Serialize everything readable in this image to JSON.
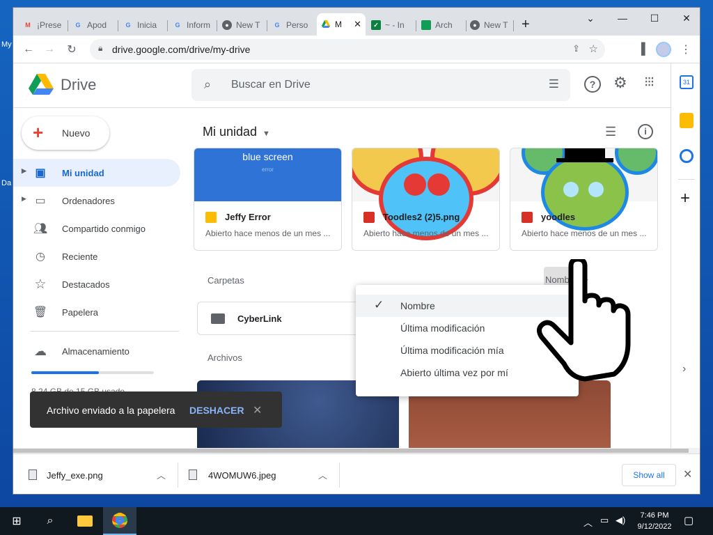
{
  "desktop": {
    "label_1": "My",
    "label_2": "Da"
  },
  "browser": {
    "tabs": [
      {
        "label": "¡Prese",
        "icon": "gmail-icon"
      },
      {
        "label": "Apod",
        "icon": "google-icon"
      },
      {
        "label": "Inicia",
        "icon": "google-icon"
      },
      {
        "label": "Inform",
        "icon": "google-icon"
      },
      {
        "label": "New T",
        "icon": "chrome-icon"
      },
      {
        "label": "Perso",
        "icon": "google-icon"
      },
      {
        "label": "M",
        "icon": "drive-icon"
      },
      {
        "label": "~ - In",
        "icon": "app-icon"
      },
      {
        "label": "Arch",
        "icon": "sheet-icon"
      },
      {
        "label": "New T",
        "icon": "chrome-icon"
      }
    ],
    "url": "drive.google.com/drive/my-drive"
  },
  "drive": {
    "logo_text": "Drive",
    "search_placeholder": "Buscar en Drive",
    "new_button": "Nuevo",
    "nav": [
      {
        "label": "Mi unidad",
        "icon": "my-drive-icon"
      },
      {
        "label": "Ordenadores",
        "icon": "computers-icon"
      },
      {
        "label": "Compartido conmigo",
        "icon": "shared-icon"
      },
      {
        "label": "Reciente",
        "icon": "clock-icon"
      },
      {
        "label": "Destacados",
        "icon": "star-icon"
      },
      {
        "label": "Papelera",
        "icon": "trash-icon"
      }
    ],
    "storage_label": "Almacenamiento",
    "storage_used": "8,24 GB de 15 GB usado",
    "storage_fraction": 0.55,
    "page_title": "Mi unidad",
    "cards": [
      {
        "name": "Jeffy Error",
        "sub": "Abierto hace menos de un mes ...",
        "thumb_text": "blue screen",
        "thumb_subtext": "error"
      },
      {
        "name": "Toodles2 (2)5.png",
        "sub": "Abierto hace menos de un mes ..."
      },
      {
        "name": "yoodles",
        "sub": "Abierto hace menos de un mes ..."
      }
    ],
    "folders_header": "Carpetas",
    "sort_label": "Nombre",
    "folder": {
      "name": "CyberLink"
    },
    "files_header": "Archivos",
    "sort_menu": [
      "Nombre",
      "Última modificación",
      "Última modificación mía",
      "Abierto última vez por mí"
    ],
    "snackbar": {
      "message": "Archivo enviado a la papelera",
      "action": "DESHACER"
    }
  },
  "downloads": {
    "items": [
      {
        "name": "Jeffy_exe.png"
      },
      {
        "name": "4WOMUW6.jpeg"
      }
    ],
    "show_all": "Show all"
  },
  "taskbar": {
    "time": "7:46 PM",
    "date": "9/12/2022"
  },
  "colors": {
    "drive_blue": "#1967d2",
    "selected_bg": "#e8f0fe",
    "taskbar": "#101820"
  }
}
